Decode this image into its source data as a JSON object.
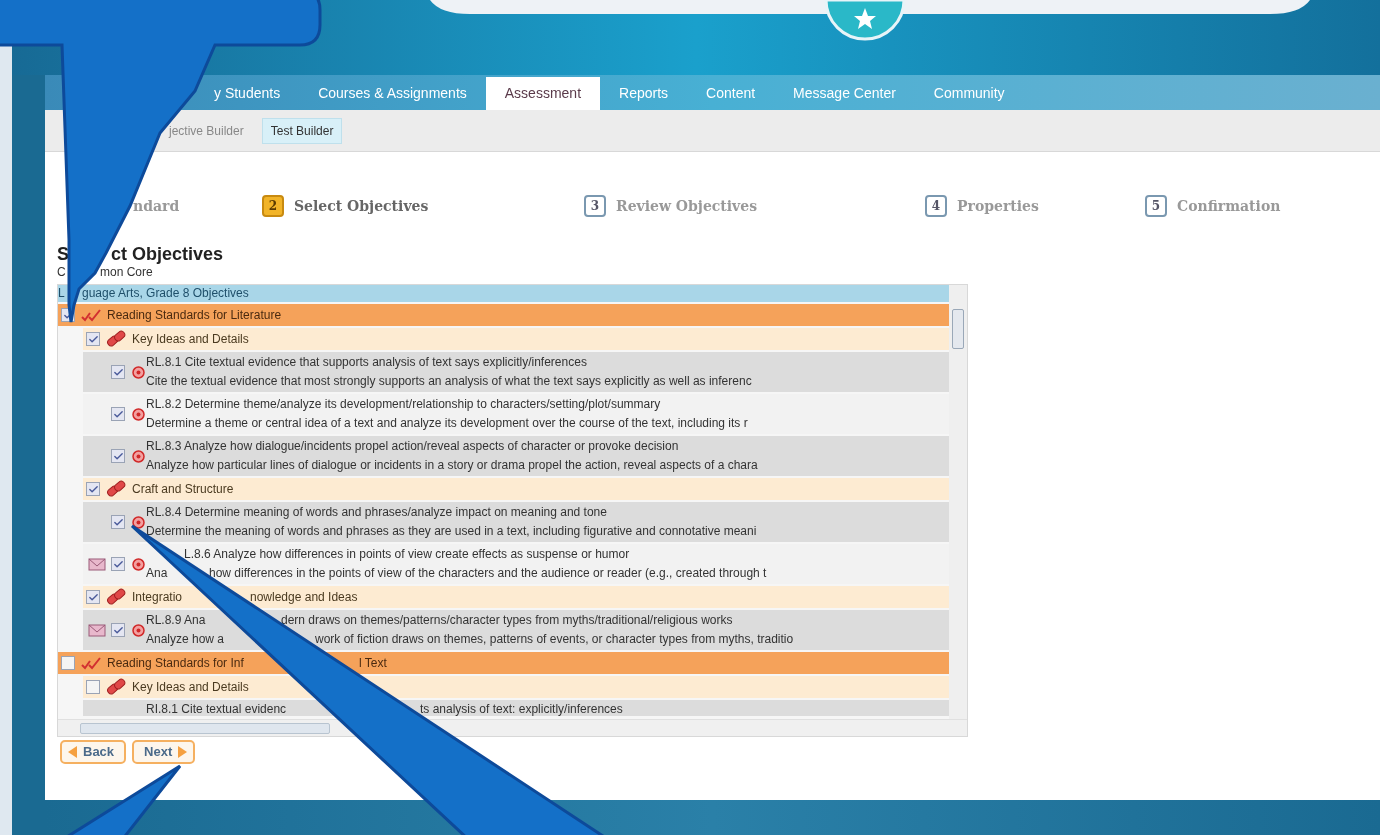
{
  "nav_tabs": [
    {
      "label": "y Students",
      "selected": false
    },
    {
      "label": "Courses & Assignments",
      "selected": false
    },
    {
      "label": "Assessment",
      "selected": true
    },
    {
      "label": "Reports",
      "selected": false
    },
    {
      "label": "Content",
      "selected": false
    },
    {
      "label": "Message Center",
      "selected": false
    },
    {
      "label": "Community",
      "selected": false
    }
  ],
  "sub_tabs": [
    {
      "label": "jective Builder",
      "selected": false
    },
    {
      "label": "Test Builder",
      "selected": true
    }
  ],
  "steps": [
    {
      "label": "ndard",
      "selected": false
    },
    {
      "number": "2",
      "label": "Select Objectives",
      "selected": true
    },
    {
      "number": "3",
      "label": "Review Objectives",
      "selected": false
    },
    {
      "number": "4",
      "label": "Properties",
      "selected": false
    },
    {
      "number": "5",
      "label": "Confirmation",
      "selected": false
    }
  ],
  "title": [
    "S",
    "ct Objectives"
  ],
  "subtitle": [
    "C",
    "mon Core"
  ],
  "tree": {
    "header": [
      "L",
      "guage Arts, Grade 8 Objectives"
    ],
    "domains": [
      {
        "title": "Reading Standards for Literature",
        "checked": true,
        "children": [
          {
            "title": "Key Ideas and Details",
            "checked": true,
            "children": [
              {
                "title": "RL.8.1 Cite textual evidence that supports analysis of text says explicitly/inferences",
                "description": "Cite the textual evidence that most strongly supports an analysis of what the text says explicitly as well as inferenc",
                "checked": true,
                "mailed": false
              },
              {
                "title": "RL.8.2 Determine theme/analyze its development/relationship to characters/setting/plot/summary",
                "description": "Determine a theme or central idea of a text and analyze its development over the course of the text, including its r",
                "checked": true,
                "mailed": false
              },
              {
                "title": "RL.8.3 Analyze how dialogue/incidents propel action/reveal aspects of character or provoke decision",
                "description": "Analyze how particular lines of dialogue or incidents in a story or drama propel the action, reveal aspects of a chara",
                "checked": true,
                "mailed": false
              }
            ]
          },
          {
            "title": "Craft and Structure",
            "checked": true,
            "children": [
              {
                "title": "RL.8.4 Determine meaning of words and phrases/analyze impact on meaning and tone",
                "description": "Determine the meaning of words and phrases as they are used in a text, including figurative and connotative meani",
                "checked": true,
                "mailed": false
              },
              {
                "title": "L.8.6 Analyze how differences in points of view create effects as suspense or humor",
                "description": [
                  "Ana",
                  "how differences in the points of view of the characters and the audience or reader (e.g., created through t"
                ],
                "checked": true,
                "mailed": true
              }
            ]
          },
          {
            "title": [
              "Integratio",
              "nowledge and Ideas"
            ],
            "checked": true,
            "children": [
              {
                "title": [
                  "RL.8.9 Ana",
                  "dern draws on themes/patterns/character types from myths/traditional/religious works"
                ],
                "description": [
                  "Analyze how a",
                  "work of fiction draws on themes, patterns of events, or character types from myths, traditio"
                ],
                "checked": true,
                "mailed": true
              }
            ]
          }
        ]
      },
      {
        "title": [
          "Reading Standards for Inf",
          "l Text"
        ],
        "checked": false,
        "children": [
          {
            "title": "Key Ideas and Details",
            "checked": false,
            "children": [
              {
                "title": [
                  "RI.8.1 Cite textual evidenc",
                  "ts analysis of text: explicitly/inferences"
                ]
              }
            ]
          }
        ]
      }
    ]
  },
  "buttons": [
    {
      "kind": "back",
      "label": "Back"
    },
    {
      "kind": "next",
      "label": "Next"
    }
  ]
}
